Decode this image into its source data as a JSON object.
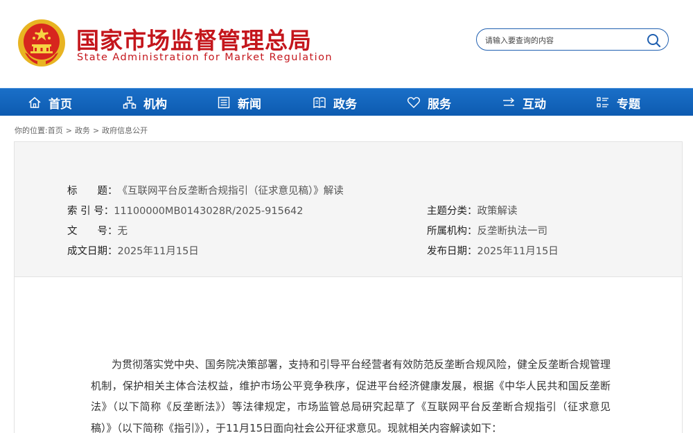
{
  "header": {
    "title_cn": "国家市场监督管理总局",
    "title_en": "State Administration for Market Regulation",
    "emblem_icon": "national-emblem-icon",
    "search": {
      "placeholder": "请输入要查询的内容",
      "button_icon": "search-icon"
    }
  },
  "nav": {
    "items": [
      {
        "label": "首页",
        "icon": "home-icon"
      },
      {
        "label": "机构",
        "icon": "org-chart-icon"
      },
      {
        "label": "新闻",
        "icon": "news-icon"
      },
      {
        "label": "政务",
        "icon": "government-book-icon"
      },
      {
        "label": "服务",
        "icon": "heart-icon"
      },
      {
        "label": "互动",
        "icon": "exchange-arrows-icon"
      },
      {
        "label": "专题",
        "icon": "topic-list-icon"
      }
    ]
  },
  "breadcrumb": {
    "prefix": "你的位置:",
    "items": [
      "首页",
      "政务",
      "政府信息公开"
    ],
    "separator": ">"
  },
  "info": {
    "title_label": "标　　题：",
    "title_value": "《互联网平台反垄断合规指引（征求意见稿）》解读",
    "index_label": "索 引 号：",
    "index_value": "11100000MB0143028R/2025-915642",
    "category_label": "主题分类：",
    "category_value": "政策解读",
    "docno_label": "文　　号：",
    "docno_value": "无",
    "org_label": "所属机构：",
    "org_value": "反垄断执法一司",
    "date_label": "成文日期：",
    "date_value": "2025年11月15日",
    "publish_label": "发布日期：",
    "publish_value": "2025年11月15日"
  },
  "content": {
    "paragraph": "为贯彻落实党中央、国务院决策部署，支持和引导平台经营者有效防范反垄断合规风险，健全反垄断合规管理机制，保护相关主体合法权益，维护市场公平竞争秩序，促进平台经济健康发展，根据《中华人民共和国反垄断法》（以下简称《反垄断法》）等法律规定，市场监管总局研究起草了《互联网平台反垄断合规指引（征求意见稿）》（以下简称《指引》），于11月15日面向社会公开征求意见。现就相关内容解读如下："
  },
  "colors": {
    "brand_red": "#c4161c",
    "nav_blue": "#1366bd",
    "search_border": "#1f5fb0"
  }
}
